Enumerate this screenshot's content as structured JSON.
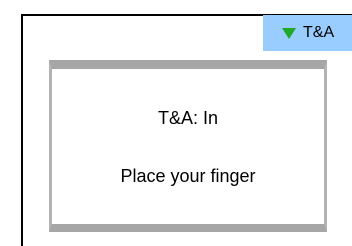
{
  "mode_indicator": {
    "icon": "down-triangle-icon",
    "label": "T&A",
    "background_color": "#99ccff",
    "icon_color": "#1fa82a"
  },
  "dialog": {
    "status": "T&A: In",
    "prompt": "Place your finger",
    "frame_color": "#a6a6a6"
  }
}
